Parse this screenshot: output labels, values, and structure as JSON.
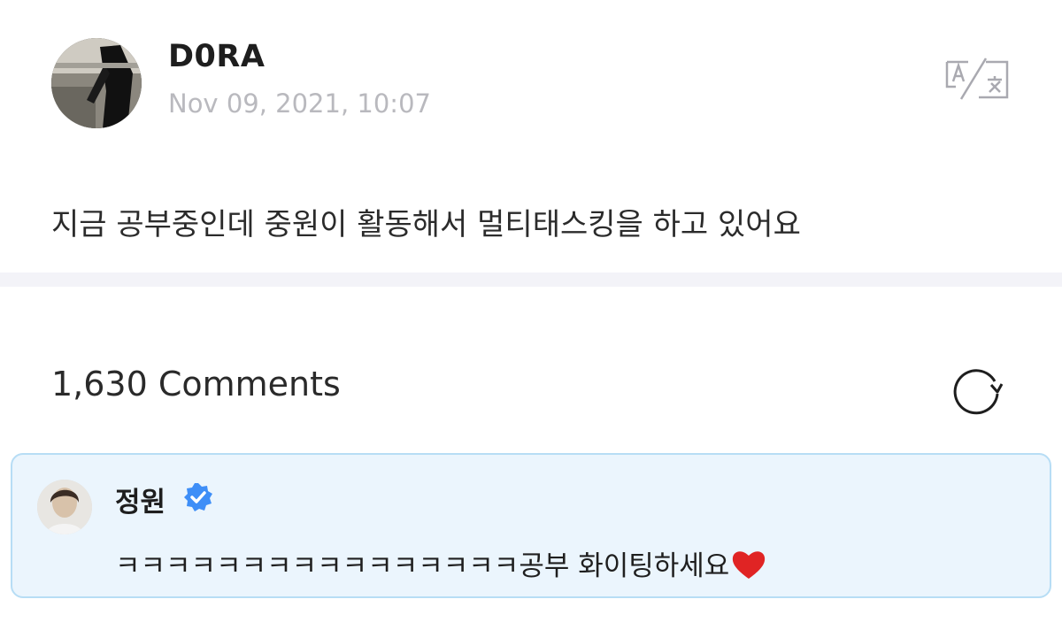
{
  "post": {
    "author_name": "D0RA",
    "timestamp": "Nov 09, 2021, 10:07",
    "body": "지금 공부중인데 중원이 활동해서 멀티태스킹을 하고 있어요",
    "translate_icon": "translate-icon"
  },
  "comments": {
    "count_label": "1,630 Comments",
    "refresh_icon": "refresh-icon",
    "items": [
      {
        "author_name": "정원",
        "verified": true,
        "text": "ㅋㅋㅋㅋㅋㅋㅋㅋㅋㅋㅋㅋㅋㅋㅋㅋ공부 화이팅하세요",
        "emoji": "heart-icon"
      }
    ]
  },
  "colors": {
    "timestamp": "#b9b9be",
    "divider": "#f3f3f8",
    "comment_bg": "#ebf5fd",
    "comment_border": "#b7ddf5",
    "verified_badge": "#3e8ef7",
    "heart": "#e02424"
  }
}
